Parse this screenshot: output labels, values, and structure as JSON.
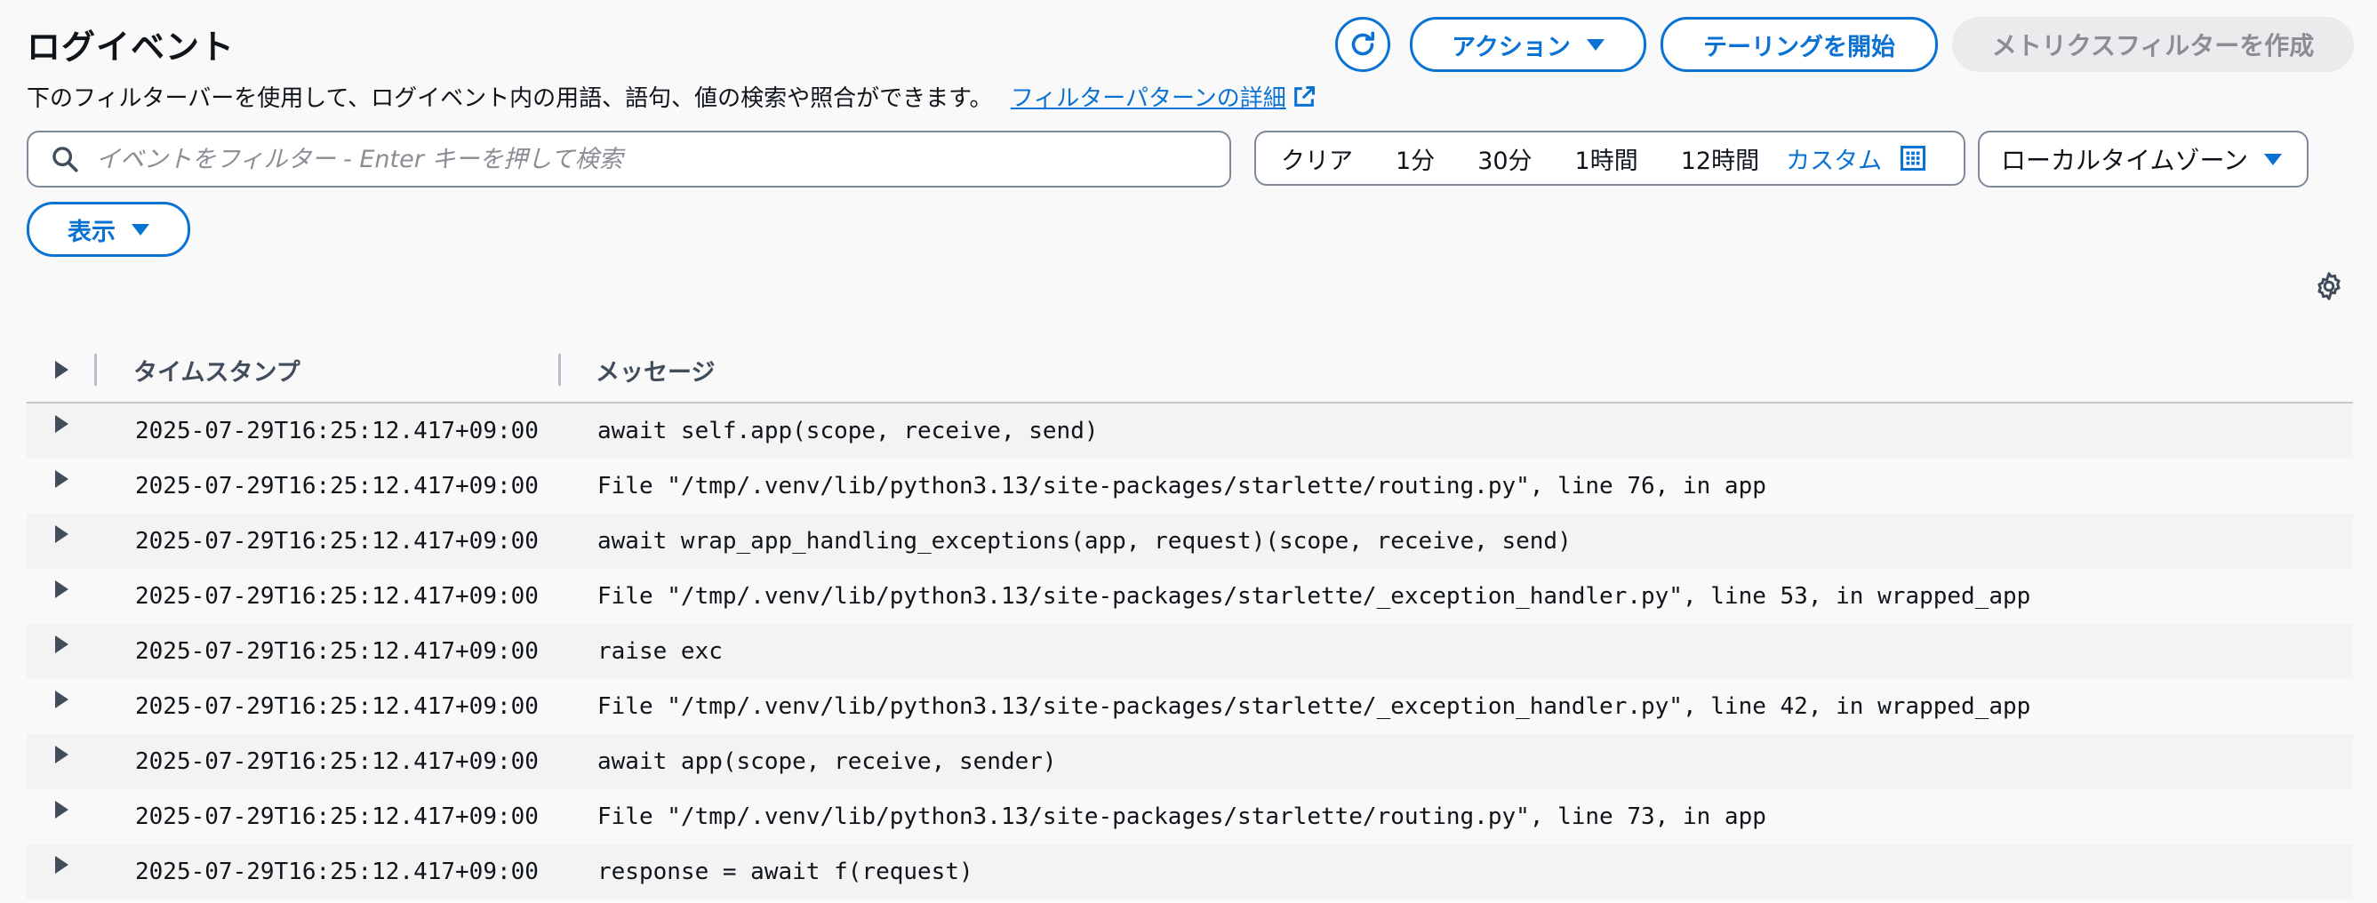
{
  "page": {
    "title": "ログイベント",
    "description": "下のフィルターバーを使用して、ログイベント内の用語、語句、値の検索や照合ができます。",
    "details_link": "フィルターパターンの詳細"
  },
  "toolbar": {
    "actions_label": "アクション",
    "tail_label": "テーリングを開始",
    "metric_filter_label": "メトリクスフィルターを作成"
  },
  "search": {
    "placeholder": "イベントをフィルター - Enter キーを押して検索",
    "value": ""
  },
  "time_range": {
    "clear": "クリア",
    "options": [
      "1分",
      "30分",
      "1時間",
      "12時間"
    ],
    "custom": "カスタム"
  },
  "timezone": {
    "label": "ローカルタイムゾーン"
  },
  "display": {
    "label": "表示"
  },
  "table": {
    "columns": [
      "タイムスタンプ",
      "メッセージ"
    ],
    "rows": [
      {
        "timestamp": "2025-07-29T16:25:12.417+09:00",
        "message": "await self.app(scope, receive, send)"
      },
      {
        "timestamp": "2025-07-29T16:25:12.417+09:00",
        "message": "File \"/tmp/.venv/lib/python3.13/site-packages/starlette/routing.py\", line 76, in app"
      },
      {
        "timestamp": "2025-07-29T16:25:12.417+09:00",
        "message": "await wrap_app_handling_exceptions(app, request)(scope, receive, send)"
      },
      {
        "timestamp": "2025-07-29T16:25:12.417+09:00",
        "message": "File \"/tmp/.venv/lib/python3.13/site-packages/starlette/_exception_handler.py\", line 53, in wrapped_app"
      },
      {
        "timestamp": "2025-07-29T16:25:12.417+09:00",
        "message": "raise exc"
      },
      {
        "timestamp": "2025-07-29T16:25:12.417+09:00",
        "message": "File \"/tmp/.venv/lib/python3.13/site-packages/starlette/_exception_handler.py\", line 42, in wrapped_app"
      },
      {
        "timestamp": "2025-07-29T16:25:12.417+09:00",
        "message": "await app(scope, receive, sender)"
      },
      {
        "timestamp": "2025-07-29T16:25:12.417+09:00",
        "message": "File \"/tmp/.venv/lib/python3.13/site-packages/starlette/routing.py\", line 73, in app"
      },
      {
        "timestamp": "2025-07-29T16:25:12.417+09:00",
        "message": "response = await f(request)"
      }
    ]
  },
  "colors": {
    "accent": "#0972d3",
    "disabled_bg": "#e9ebed",
    "disabled_text": "#8c8c94"
  },
  "icons": [
    "refresh-icon",
    "external-link-icon",
    "search-icon",
    "calendar-icon",
    "gear-icon",
    "expand-icon"
  ]
}
